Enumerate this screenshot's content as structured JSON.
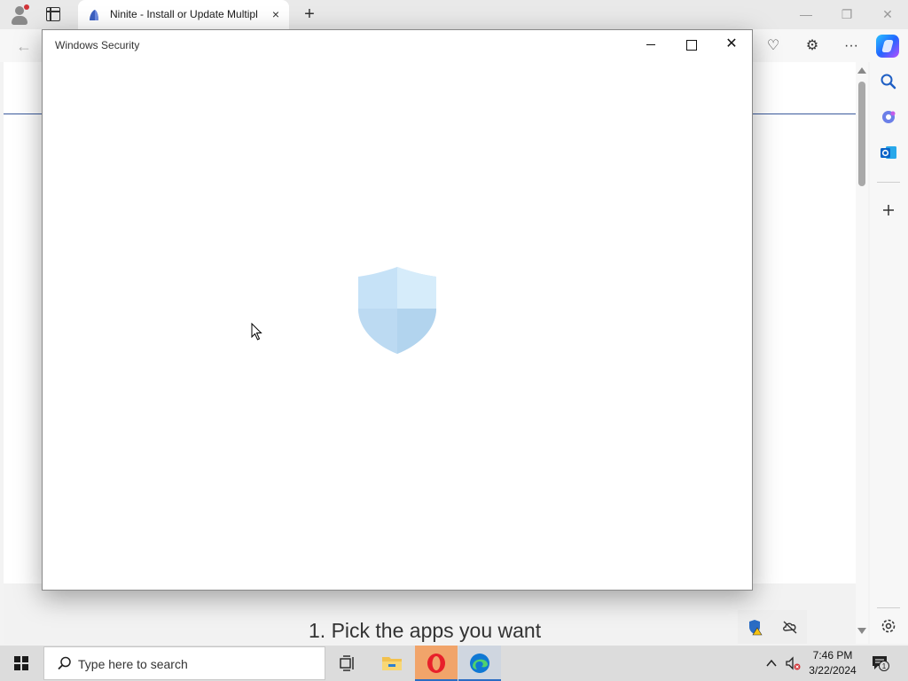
{
  "browser": {
    "tab": {
      "title": "Ninite - Install or Update Multipl",
      "close_icon": "×"
    },
    "new_tab_icon": "+",
    "window_controls": {
      "minimize": "—",
      "restore": "❐",
      "close": "✕"
    },
    "back_icon": "←",
    "toolbar_icons": {
      "performance": "♡",
      "extensions": "⚙",
      "more": "···"
    }
  },
  "page": {
    "heading": "1. Pick the apps you want",
    "line_color": "#3a5a9c"
  },
  "sidebar": {
    "icons": [
      "search-icon",
      "copilot-apps-icon",
      "outlook-icon",
      "add-icon",
      "settings-icon"
    ]
  },
  "dialog": {
    "title": "Windows Security",
    "controls": {
      "close": "✕"
    },
    "shield_color": "#c9e3f7"
  },
  "taskbar": {
    "search_placeholder": "Type here to search",
    "clock": {
      "time": "7:46 PM",
      "date": "3/22/2024"
    },
    "apps": [
      "task-view",
      "file-explorer",
      "opera",
      "edge"
    ],
    "notification_count": "1"
  }
}
